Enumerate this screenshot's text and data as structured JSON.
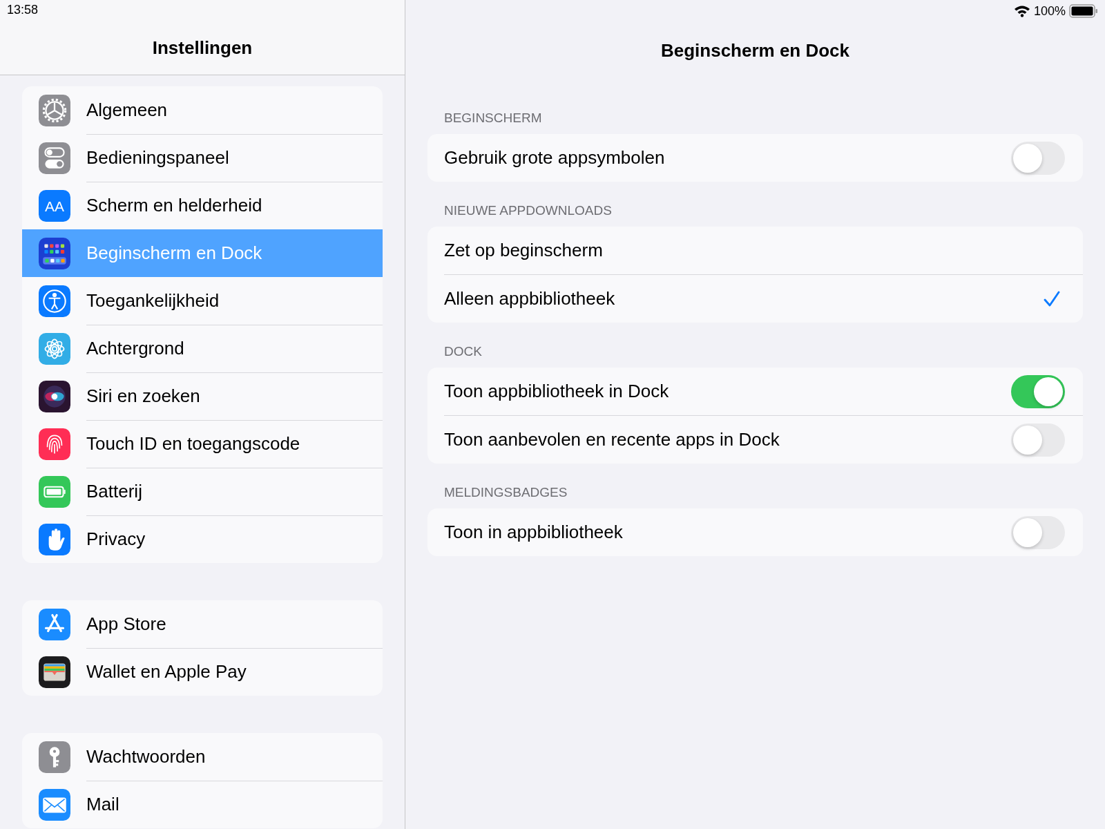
{
  "status_bar": {
    "time": "13:58",
    "battery": "100%"
  },
  "sidebar": {
    "title": "Instellingen",
    "groups": [
      [
        {
          "label": "Algemeen",
          "selected": false
        },
        {
          "label": "Bedieningspaneel",
          "selected": false
        },
        {
          "label": "Scherm en helderheid",
          "selected": false,
          "icon_text": "AA"
        },
        {
          "label": "Beginscherm en Dock",
          "selected": true
        },
        {
          "label": "Toegankelijkheid",
          "selected": false
        },
        {
          "label": "Achtergrond",
          "selected": false
        },
        {
          "label": "Siri en zoeken",
          "selected": false
        },
        {
          "label": "Touch ID en toegangscode",
          "selected": false
        },
        {
          "label": "Batterij",
          "selected": false
        },
        {
          "label": "Privacy",
          "selected": false
        }
      ],
      [
        {
          "label": "App Store",
          "selected": false
        },
        {
          "label": "Wallet en Apple Pay",
          "selected": false
        }
      ],
      [
        {
          "label": "Wachtwoorden",
          "selected": false
        },
        {
          "label": "Mail",
          "selected": false
        }
      ]
    ]
  },
  "detail": {
    "title": "Beginscherm en Dock",
    "sections": [
      {
        "header": "BEGINSCHERM",
        "rows": [
          {
            "label": "Gebruik grote appsymbolen",
            "kind": "toggle",
            "on": false
          }
        ]
      },
      {
        "header": "NIEUWE APPDOWNLOADS",
        "rows": [
          {
            "label": "Zet op beginscherm",
            "kind": "choice",
            "selected": false
          },
          {
            "label": "Alleen appbibliotheek",
            "kind": "choice",
            "selected": true
          }
        ]
      },
      {
        "header": "DOCK",
        "rows": [
          {
            "label": "Toon appbibliotheek in Dock",
            "kind": "toggle",
            "on": true
          },
          {
            "label": "Toon aanbevolen en recente apps in Dock",
            "kind": "toggle",
            "on": false
          }
        ]
      },
      {
        "header": "MELDINGSBADGES",
        "rows": [
          {
            "label": "Toon in appbibliotheek",
            "kind": "toggle",
            "on": false
          }
        ]
      }
    ]
  }
}
